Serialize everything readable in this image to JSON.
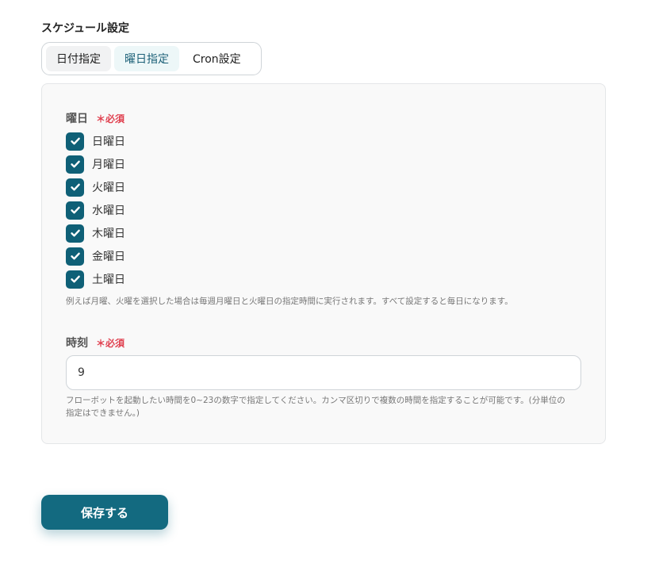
{
  "section": {
    "title": "スケジュール設定"
  },
  "tabs": [
    {
      "label": "日付指定"
    },
    {
      "label": "曜日指定"
    },
    {
      "label": "Cron設定"
    }
  ],
  "weekday_field": {
    "label": "曜日",
    "required": "＊必須",
    "days": [
      {
        "label": "日曜日",
        "checked": true
      },
      {
        "label": "月曜日",
        "checked": true
      },
      {
        "label": "火曜日",
        "checked": true
      },
      {
        "label": "水曜日",
        "checked": true
      },
      {
        "label": "木曜日",
        "checked": true
      },
      {
        "label": "金曜日",
        "checked": true
      },
      {
        "label": "土曜日",
        "checked": true
      }
    ],
    "helper": "例えば月曜、火曜を選択した場合は毎週月曜日と火曜日の指定時間に実行されます。すべて設定すると毎日になります。"
  },
  "time_field": {
    "label": "時刻",
    "required": "＊必須",
    "value": "9",
    "helper_line1": "フローボットを起動したい時間を0~23の数字で指定してください。カンマ区切りで複数の時間を指定することが可能です。(分単位の",
    "helper_line2": "指定はできません。)"
  },
  "actions": {
    "save_label": "保存する"
  },
  "colors": {
    "accent": "#136a80",
    "checkbox": "#0f6077",
    "required": "#e0404f"
  }
}
